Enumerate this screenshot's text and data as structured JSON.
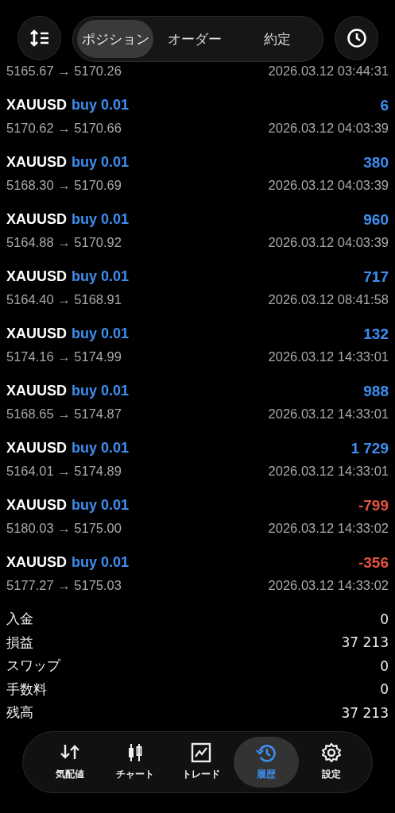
{
  "header": {
    "tabs": [
      {
        "label": "ポジション",
        "selected": true
      },
      {
        "label": "オーダー",
        "selected": false
      },
      {
        "label": "約定",
        "selected": false
      }
    ]
  },
  "partial_row": {
    "prices": "5165.67 → 5170.26",
    "time": "2026.03.12 03:44:31"
  },
  "deals": [
    {
      "symbol": "XAUUSD",
      "side": "buy 0.01",
      "profit": "6",
      "color": "#3d8ef2",
      "prices": "5170.62 → 5170.66",
      "time": "2026.03.12 04:03:39"
    },
    {
      "symbol": "XAUUSD",
      "side": "buy 0.01",
      "profit": "380",
      "color": "#3d8ef2",
      "prices": "5168.30 → 5170.69",
      "time": "2026.03.12 04:03:39"
    },
    {
      "symbol": "XAUUSD",
      "side": "buy 0.01",
      "profit": "960",
      "color": "#3d8ef2",
      "prices": "5164.88 → 5170.92",
      "time": "2026.03.12 04:03:39"
    },
    {
      "symbol": "XAUUSD",
      "side": "buy 0.01",
      "profit": "717",
      "color": "#3d8ef2",
      "prices": "5164.40 → 5168.91",
      "time": "2026.03.12 08:41:58"
    },
    {
      "symbol": "XAUUSD",
      "side": "buy 0.01",
      "profit": "132",
      "color": "#3d8ef2",
      "prices": "5174.16 → 5174.99",
      "time": "2026.03.12 14:33:01"
    },
    {
      "symbol": "XAUUSD",
      "side": "buy 0.01",
      "profit": "988",
      "color": "#3d8ef2",
      "prices": "5168.65 → 5174.87",
      "time": "2026.03.12 14:33:01"
    },
    {
      "symbol": "XAUUSD",
      "side": "buy 0.01",
      "profit": "1 729",
      "color": "#3d8ef2",
      "prices": "5164.01 → 5174.89",
      "time": "2026.03.12 14:33:01"
    },
    {
      "symbol": "XAUUSD",
      "side": "buy 0.01",
      "profit": "-799",
      "color": "#e4533f",
      "prices": "5180.03 → 5175.00",
      "time": "2026.03.12 14:33:02"
    },
    {
      "symbol": "XAUUSD",
      "side": "buy 0.01",
      "profit": "-356",
      "color": "#e4533f",
      "prices": "5177.27 → 5175.03",
      "time": "2026.03.12 14:33:02"
    }
  ],
  "summary": [
    {
      "label": "入金",
      "value": "0"
    },
    {
      "label": "損益",
      "value": "37 213"
    },
    {
      "label": "スワップ",
      "value": "0"
    },
    {
      "label": "手数料",
      "value": "0"
    },
    {
      "label": "残高",
      "value": "37 213"
    }
  ],
  "nav": [
    {
      "label": "気配値",
      "kind": "quotes",
      "selected": false
    },
    {
      "label": "チャート",
      "kind": "chart",
      "selected": false
    },
    {
      "label": "トレード",
      "kind": "trade",
      "selected": false
    },
    {
      "label": "履歴",
      "kind": "history",
      "selected": true
    },
    {
      "label": "設定",
      "kind": "settings",
      "selected": false
    }
  ]
}
